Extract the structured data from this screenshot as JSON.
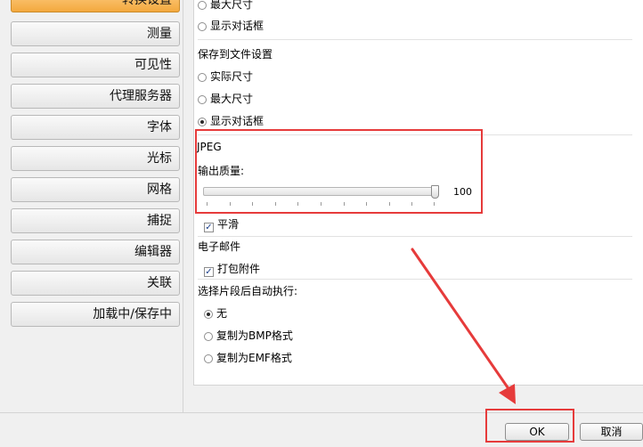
{
  "sidebar": {
    "items": [
      {
        "label": "转换设置",
        "active": true
      },
      {
        "label": "测量"
      },
      {
        "label": "可见性"
      },
      {
        "label": "代理服务器"
      },
      {
        "label": "字体"
      },
      {
        "label": "光标"
      },
      {
        "label": "网格"
      },
      {
        "label": "捕捉"
      },
      {
        "label": "编辑器"
      },
      {
        "label": "关联"
      },
      {
        "label": "加载中/保存中"
      }
    ]
  },
  "clipboard_group": {
    "options": [
      "最大尺寸",
      "显示对话框"
    ]
  },
  "save_file_group": {
    "title": "保存到文件设置",
    "options": [
      "实际尺寸",
      "最大尺寸",
      "显示对话框"
    ],
    "selected": "显示对话框"
  },
  "jpeg_group": {
    "title": "JPEG",
    "quality_label": "输出质量:",
    "quality_value": "100",
    "quality_level": 100,
    "smooth_label": "平滑",
    "smooth_checked": true
  },
  "email_group": {
    "title": "电子邮件",
    "zip_label": "打包附件",
    "zip_checked": true
  },
  "after_clip_group": {
    "title": "选择片段后自动执行:",
    "options": [
      "无",
      "复制为BMP格式",
      "复制为EMF格式"
    ],
    "selected": "无"
  },
  "buttons": {
    "ok": "OK",
    "cancel": "取消"
  },
  "colors": {
    "highlight": "#e63b3b",
    "active_nav": "#f3a93e"
  }
}
